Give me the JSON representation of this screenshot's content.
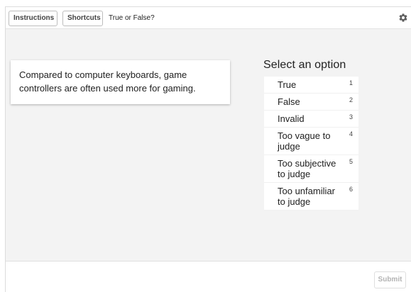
{
  "toolbar": {
    "instructions_label": "Instructions",
    "shortcuts_label": "Shortcuts",
    "task_title": "True or False?"
  },
  "statement": {
    "text": "Compared to computer keyboards, game controllers are often used more for gaming."
  },
  "options_panel": {
    "heading": "Select an option",
    "options": [
      {
        "label": "True",
        "key": "1"
      },
      {
        "label": "False",
        "key": "2"
      },
      {
        "label": "Invalid",
        "key": "3"
      },
      {
        "label": "Too vague to judge",
        "key": "4"
      },
      {
        "label": "Too subjective to judge",
        "key": "5"
      },
      {
        "label": "Too unfamiliar to judge",
        "key": "6"
      }
    ]
  },
  "footer": {
    "submit_label": "Submit"
  },
  "icons": {
    "settings": "gear-icon"
  },
  "colors": {
    "panel_background": "#f3f3f3",
    "submit_disabled_text": "#b3b3b3"
  }
}
